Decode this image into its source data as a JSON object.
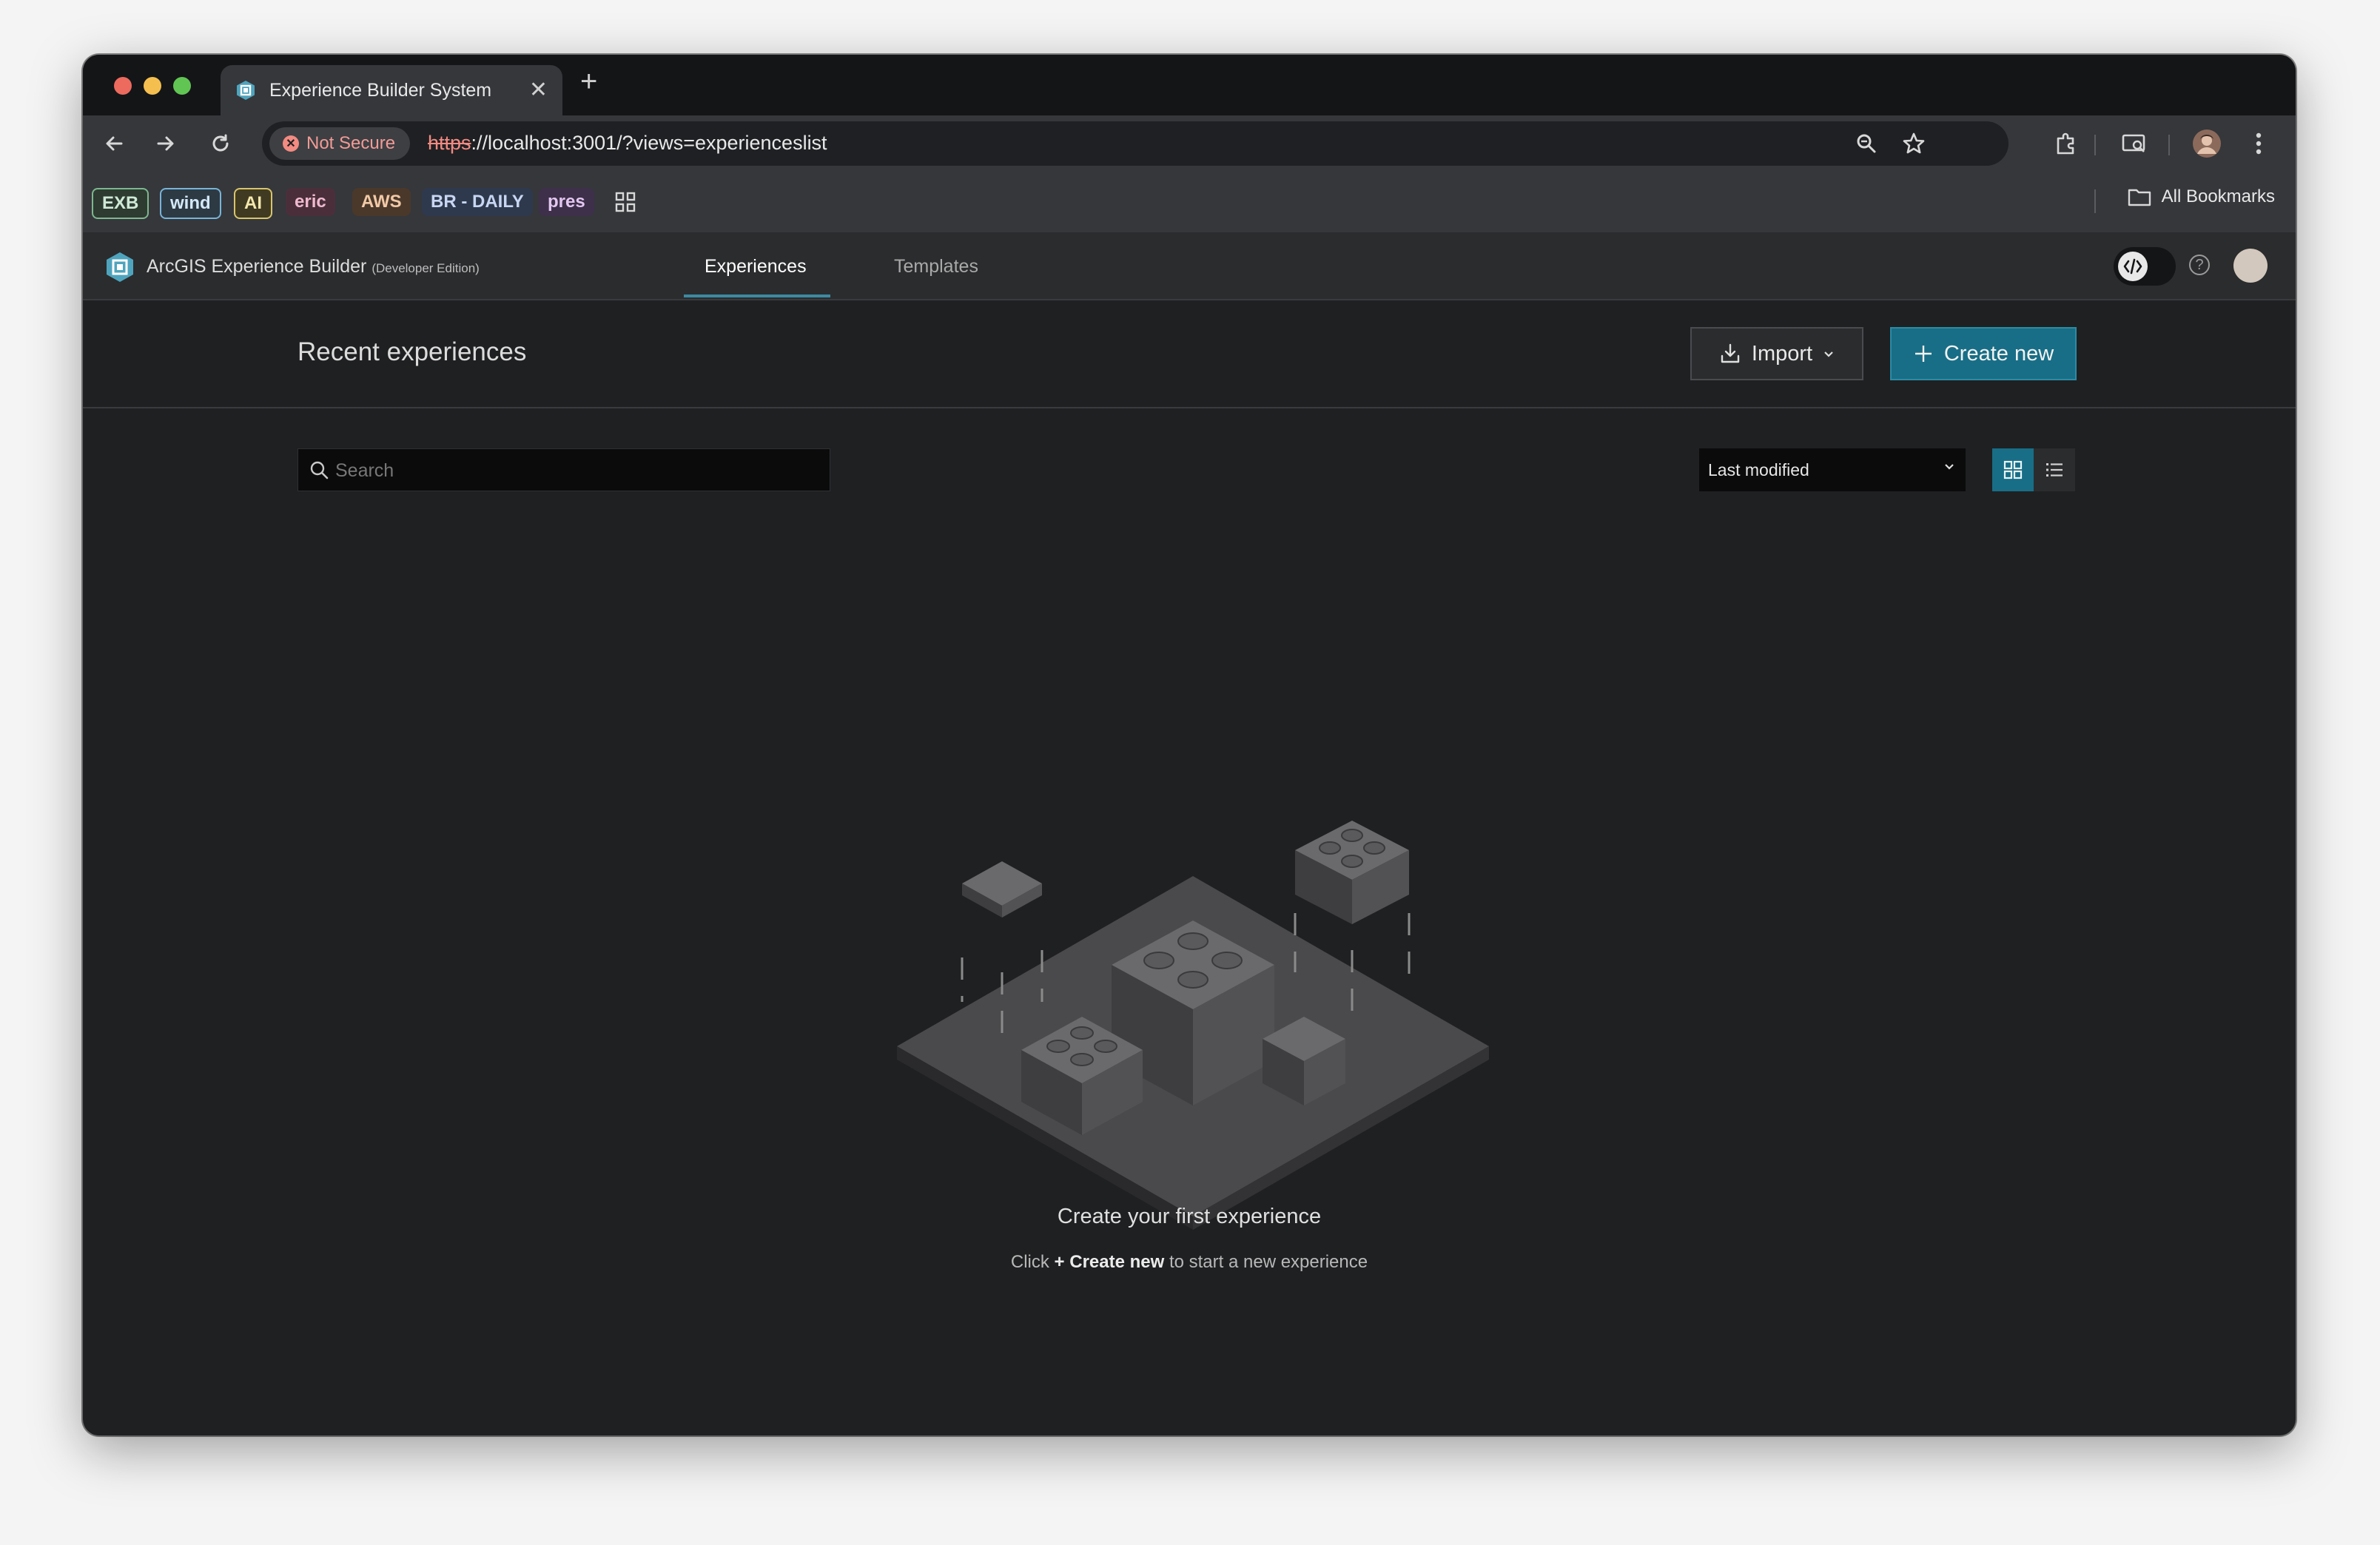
{
  "browser": {
    "tab_title": "Experience Builder System",
    "new_tab_symbol": "+",
    "close_symbol": "✕",
    "security_chip": "Not Secure",
    "url_scheme": "https",
    "url_rest": "://localhost:3001/?views=experienceslist",
    "bookmarks": [
      "EXB",
      "wind",
      "AI",
      "eric",
      "AWS",
      "BR - DAILY",
      "pres"
    ],
    "all_bookmarks": "All Bookmarks",
    "icons": [
      "back-icon",
      "forward-icon",
      "reload-icon",
      "zoom-icon",
      "star-icon",
      "extensions-icon",
      "cast-icon",
      "profile-icon",
      "menu-icon",
      "apps-grid-icon",
      "folder-icon"
    ]
  },
  "app": {
    "name": "ArcGIS Experience Builder",
    "edition": "(Developer Edition)",
    "nav": {
      "experiences": "Experiences",
      "templates": "Templates"
    },
    "accent": "#186e86"
  },
  "page": {
    "title": "Recent experiences",
    "import_label": "Import",
    "create_label": "Create new",
    "search_placeholder": "Search",
    "sort_value": "Last modified"
  },
  "empty_state": {
    "title": "Create your first experience",
    "sub_prefix": "Click ",
    "sub_bold": "+ Create new",
    "sub_suffix": " to start a new experience"
  }
}
